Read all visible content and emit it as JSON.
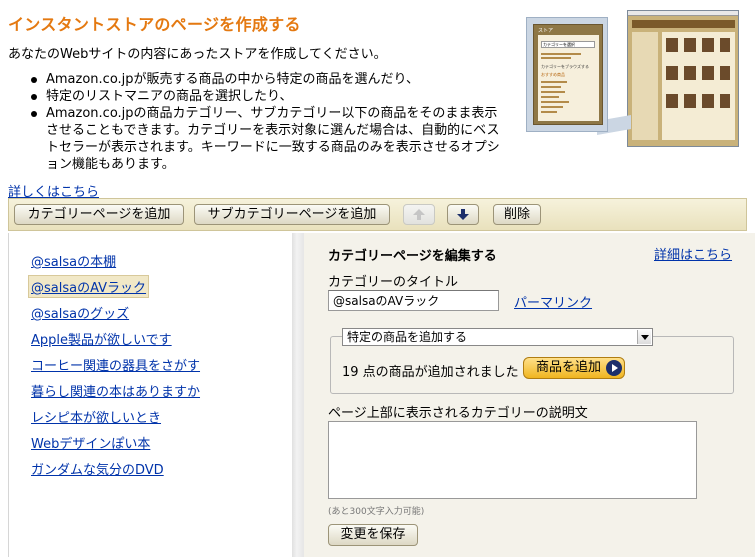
{
  "header": {
    "title": "インスタントストアのページを作成する",
    "description": "あなたのWebサイトの内容にあったストアを作成してください。",
    "bullets": [
      "Amazon.co.jpが販売する商品の中から特定の商品を選んだり、",
      "特定のリストマニアの商品を選択したり、",
      "Amazon.co.jpの商品カテゴリー、サブカテゴリー以下の商品をそのまま表示させることもできます。カテゴリーを表示対象に選んだ場合は、自動的にベストセラーが表示されます。キーワードに一致する商品のみを表示させるオプション機能もあります。"
    ],
    "more_link": "詳しくはこちら"
  },
  "preview": {
    "small_title": "ストア",
    "small_select": "カテゴリーを選択",
    "small_category_heading": "カテゴリーをブラウズする",
    "small_featured": "おすすめ商品"
  },
  "toolbar": {
    "add_category": "カテゴリーページを追加",
    "add_subcategory": "サブカテゴリーページを追加",
    "delete": "削除"
  },
  "nav": {
    "items": [
      "@salsaの本棚",
      "@salsaのAVラック",
      "@salsaのグッズ",
      "Apple製品が欲しいです",
      "コーヒー関連の器具をさがす",
      "暮らし関連の本はありますか",
      "レシピ本が欲しいとき",
      "Webデザインぽい本",
      "ガンダムな気分のDVD"
    ],
    "selected_index": 1
  },
  "editor": {
    "heading": "カテゴリーページを編集する",
    "detail_link": "詳細はこちら",
    "title_label": "カテゴリーのタイトル",
    "title_value": "@salsaのAVラック",
    "permalink": "パーマリンク",
    "select_value": "特定の商品を追加する",
    "count_text": "19 点の商品が追加されました",
    "add_product": "商品を追加",
    "desc_label": "ページ上部に表示されるカテゴリーの説明文",
    "char_note": "(あと300文字入力可能)",
    "save": "変更を保存"
  },
  "colors": {
    "title": "#e47911",
    "link": "#0033aa",
    "add_button": "#f0b520",
    "toolbar_bg": "#efe8cc",
    "editor_bg": "#f4f2ea"
  }
}
